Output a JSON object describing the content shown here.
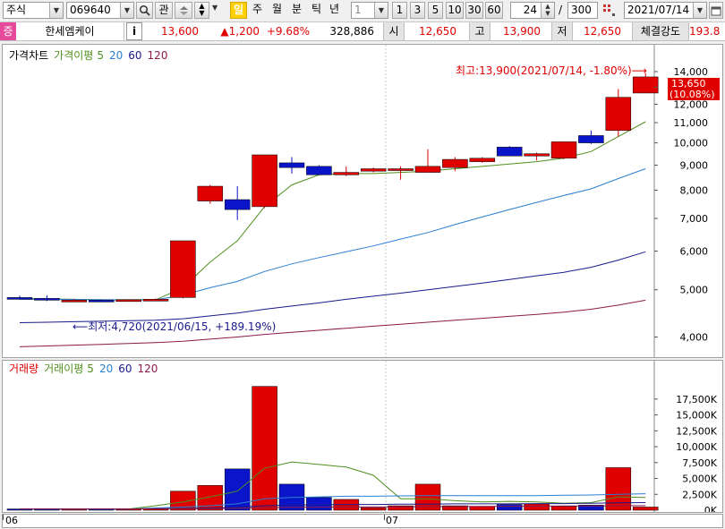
{
  "toolbar": {
    "market_select": "주식",
    "code_value": "069640",
    "search_icon": "magnifier-icon",
    "watch_label": "관",
    "period_tabs": [
      "일",
      "주",
      "월",
      "분",
      "틱",
      "년"
    ],
    "interval_select": "1",
    "interval_buttons": [
      "1",
      "3",
      "5",
      "10",
      "30",
      "60"
    ],
    "view_count": "24",
    "slash": "/",
    "total_count": "300",
    "date_value": "2021/07/14"
  },
  "infobar": {
    "badge": "증",
    "stock_name": "한세엠케이",
    "info_button": "i",
    "price": "13,600",
    "change": "▲1,200",
    "change_pct": "+9.68%",
    "volume": "328,886",
    "open_label": "시",
    "open_value": "12,650",
    "high_label": "고",
    "high_value": "13,900",
    "low_label": "저",
    "low_value": "12,650",
    "strength_label": "체결강도",
    "strength_value": "193.8"
  },
  "price_panel": {
    "legend": [
      "가격차트",
      "가격이평",
      "5",
      "20",
      "60",
      "120"
    ],
    "legend_colors": [
      "#000000",
      "#4f8f1f",
      "#4f8f1f",
      "#2a7fd0",
      "#00008b",
      "#8b1a4a"
    ],
    "max_annotation": "최고:13,900(2021/07/14, -1.80%)⟶",
    "min_annotation": "⟵최저:4,720(2021/06/15, +189.19%)",
    "last_price_box": [
      "13,650",
      "(10.08%)"
    ],
    "y_labels": [
      "14,000",
      "13,000",
      "12,000",
      "11,000",
      "10,000",
      "9,000",
      "8,000",
      "7,000",
      "6,000",
      "5,000",
      "4,000"
    ]
  },
  "volume_panel": {
    "legend": [
      "거래량",
      "거래이평",
      "5",
      "20",
      "60",
      "120"
    ],
    "legend_colors": [
      "#e00000",
      "#4f8f1f",
      "#4f8f1f",
      "#2a7fd0",
      "#00008b",
      "#8b1a4a"
    ],
    "y_labels": [
      "17,500K",
      "15,000K",
      "12,500K",
      "10,000K",
      "7,500K",
      "5,000K",
      "2,500K",
      "0K"
    ]
  },
  "x_axis": {
    "labels": [
      "06",
      "07"
    ]
  },
  "colors": {
    "up": "#e00000",
    "down": "#0a14c8",
    "ma5": "#4f8f1f",
    "ma20": "#2a7fd0",
    "ma60": "#1a1a8c",
    "ma120": "#8b1a4a"
  },
  "chart_data": {
    "type": "candlestick",
    "yscale": "log",
    "ylim": [
      3700,
      14600
    ],
    "candles": [
      {
        "o": 4820,
        "h": 4860,
        "l": 4780,
        "c": 4800
      },
      {
        "o": 4800,
        "h": 4870,
        "l": 4740,
        "c": 4760
      },
      {
        "o": 4760,
        "h": 4790,
        "l": 4720,
        "c": 4760
      },
      {
        "o": 4760,
        "h": 4780,
        "l": 4730,
        "c": 4750
      },
      {
        "o": 4750,
        "h": 4780,
        "l": 4730,
        "c": 4770
      },
      {
        "o": 4770,
        "h": 4800,
        "l": 4740,
        "c": 4780
      },
      {
        "o": 4820,
        "h": 6300,
        "l": 4800,
        "c": 6300
      },
      {
        "o": 7600,
        "h": 8200,
        "l": 7500,
        "c": 8150
      },
      {
        "o": 7650,
        "h": 8150,
        "l": 6950,
        "c": 7300
      },
      {
        "o": 7400,
        "h": 9450,
        "l": 7350,
        "c": 9450
      },
      {
        "o": 9100,
        "h": 9350,
        "l": 8650,
        "c": 8900
      },
      {
        "o": 8950,
        "h": 9000,
        "l": 8600,
        "c": 8600
      },
      {
        "o": 8600,
        "h": 8950,
        "l": 8550,
        "c": 8700
      },
      {
        "o": 8750,
        "h": 8900,
        "l": 8700,
        "c": 8850
      },
      {
        "o": 8800,
        "h": 8950,
        "l": 8400,
        "c": 8850
      },
      {
        "o": 8700,
        "h": 9700,
        "l": 8700,
        "c": 8950
      },
      {
        "o": 8900,
        "h": 9350,
        "l": 8750,
        "c": 9250
      },
      {
        "o": 9150,
        "h": 9350,
        "l": 9100,
        "c": 9300
      },
      {
        "o": 9800,
        "h": 9850,
        "l": 9400,
        "c": 9400
      },
      {
        "o": 9400,
        "h": 9550,
        "l": 9200,
        "c": 9500
      },
      {
        "o": 9300,
        "h": 10050,
        "l": 9250,
        "c": 10050
      },
      {
        "o": 10350,
        "h": 10600,
        "l": 9950,
        "c": 10000
      },
      {
        "o": 10600,
        "h": 12900,
        "l": 10300,
        "c": 12400
      },
      {
        "o": 12650,
        "h": 13900,
        "l": 12650,
        "c": 13650
      }
    ],
    "volume_unit": "K",
    "volume": [
      200,
      200,
      200,
      200,
      200,
      200,
      3000,
      3900,
      6500,
      19500,
      4100,
      2000,
      1700,
      400,
      700,
      4100,
      700,
      600,
      900,
      1000,
      600,
      800,
      6700,
      500
    ],
    "ma_price": {
      "5": [
        4800,
        4790,
        4780,
        4770,
        4770,
        4770,
        5050,
        5700,
        6300,
        7400,
        8200,
        8600,
        8650,
        8650,
        8700,
        8750,
        8850,
        8950,
        9050,
        9150,
        9300,
        9600,
        10300,
        11050
      ],
      "20": [
        4780,
        4780,
        4775,
        4770,
        4770,
        4770,
        4870,
        5050,
        5200,
        5450,
        5650,
        5820,
        5980,
        6150,
        6350,
        6550,
        6800,
        7050,
        7300,
        7550,
        7800,
        8050,
        8450,
        8850
      ],
      "60": [
        4280,
        4290,
        4300,
        4310,
        4320,
        4330,
        4360,
        4420,
        4480,
        4560,
        4630,
        4700,
        4780,
        4850,
        4920,
        5000,
        5080,
        5160,
        5250,
        5340,
        5430,
        5560,
        5750,
        5980
      ],
      "120": [
        3820,
        3835,
        3850,
        3865,
        3880,
        3895,
        3920,
        3960,
        4000,
        4050,
        4090,
        4130,
        4170,
        4210,
        4250,
        4290,
        4330,
        4370,
        4410,
        4450,
        4500,
        4560,
        4650,
        4760
      ]
    },
    "ma_volume": {
      "5": [
        200,
        200,
        200,
        200,
        200,
        700,
        1300,
        2100,
        3000,
        6600,
        7600,
        7200,
        6800,
        5500,
        1800,
        1800,
        1500,
        1300,
        1400,
        1300,
        1100,
        1200,
        2100,
        2000
      ],
      "20": [
        200,
        200,
        200,
        200,
        200,
        350,
        500,
        700,
        1000,
        1800,
        2000,
        2100,
        2200,
        2200,
        2250,
        2300,
        2300,
        2300,
        2300,
        2300,
        2350,
        2400,
        2500,
        2600
      ],
      "60": [
        200,
        200,
        200,
        200,
        200,
        250,
        300,
        350,
        450,
        700,
        800,
        850,
        900,
        900,
        950,
        950,
        1000,
        1000,
        1000,
        1050,
        1050,
        1100,
        1150,
        1200
      ],
      "120": [
        200,
        200,
        200,
        200,
        200,
        220,
        240,
        260,
        300,
        400,
        450,
        480,
        500,
        520,
        540,
        560,
        580,
        600,
        620,
        640,
        660,
        680,
        700,
        720
      ]
    }
  }
}
